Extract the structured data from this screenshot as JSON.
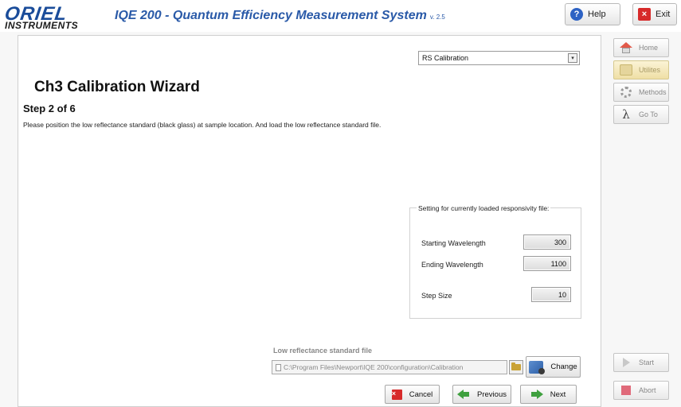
{
  "header": {
    "logo_top": "ORIEL",
    "logo_bottom": "INSTRUMENTS",
    "title": "IQE 200 - Quantum Efficiency Measurement System",
    "version": "v. 2.5",
    "help_label": "Help",
    "exit_label": "Exit"
  },
  "mode_select": {
    "selected": "RS Calibration"
  },
  "wizard": {
    "title": "Ch3 Calibration Wizard",
    "step": "Step 2 of  6",
    "instruction": "Please position the low reflectance standard (black glass) at sample location. And load the low reflectance standard file."
  },
  "settings": {
    "legend": "Setting for currently loaded responsivity file:",
    "starting_wavelength_label": "Starting Wavelength",
    "starting_wavelength_value": "300",
    "ending_wavelength_label": "Ending Wavelength",
    "ending_wavelength_value": "1100",
    "step_size_label": "Step Size",
    "step_size_value": "10"
  },
  "file": {
    "label": "Low reflectance standard file",
    "path": "C:\\Program Files\\Newport\\IQE 200\\configuration\\Calibration",
    "change_label": "Change"
  },
  "actions": {
    "cancel": "Cancel",
    "previous": "Previous",
    "next": "Next"
  },
  "sidebar": {
    "home": "Home",
    "utilities": "Utilites",
    "methods": "Methods",
    "goto": "Go To",
    "start": "Start",
    "abort": "Abort"
  },
  "icons": [
    "help-icon",
    "exit-icon",
    "dropdown-arrow-icon",
    "document-icon",
    "folder-icon",
    "change-icon",
    "cancel-icon",
    "previous-arrow-icon",
    "next-arrow-icon",
    "home-icon",
    "utilities-icon",
    "methods-gear-icon",
    "lambda-icon",
    "start-play-icon",
    "abort-stop-icon"
  ]
}
